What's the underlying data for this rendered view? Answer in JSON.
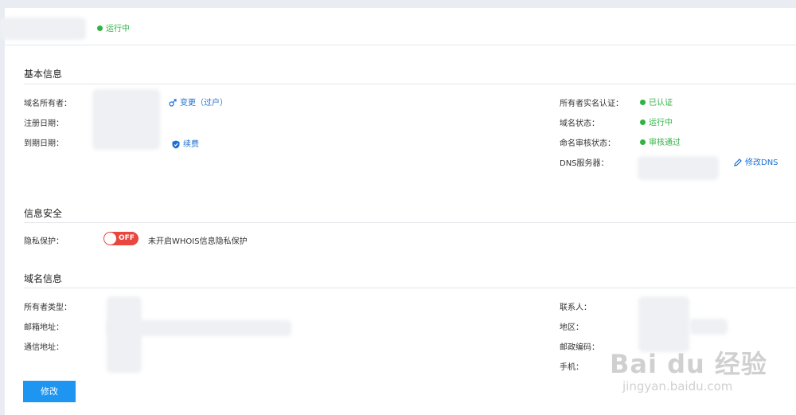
{
  "header": {
    "status": "运行中"
  },
  "basic": {
    "title": "基本信息",
    "owner_label": "域名所有者：",
    "change_link": "变更（过户）",
    "reg_date_label": "注册日期：",
    "exp_date_label": "到期日期：",
    "renew_link": "续费",
    "realname_label": "所有者实名认证：",
    "realname_value": "已认证",
    "domain_status_label": "域名状态：",
    "domain_status_value": "运行中",
    "naming_review_label": "命名审核状态：",
    "naming_review_value": "审核通过",
    "dns_label": "DNS服务器：",
    "dns_modify_link": "修改DNS"
  },
  "security": {
    "title": "信息安全",
    "privacy_label": "隐私保护：",
    "toggle_text": "OFF",
    "privacy_desc": "未开启WHOIS信息隐私保护"
  },
  "domain_info": {
    "title": "域名信息",
    "owner_type_label": "所有者类型：",
    "email_label": "邮箱地址：",
    "address_label": "通信地址：",
    "contact_label": "联系人：",
    "region_label": "地区：",
    "postcode_label": "邮政编码：",
    "phone_label": "手机："
  },
  "actions": {
    "modify_button": "修改"
  },
  "watermark": {
    "brand": "Bai du 经验",
    "url": "jingyan.baidu.com"
  },
  "colors": {
    "green": "#2fb344",
    "link": "#1a6fd1",
    "toggle_off": "#e8463e",
    "primary_button": "#1e95f0"
  }
}
